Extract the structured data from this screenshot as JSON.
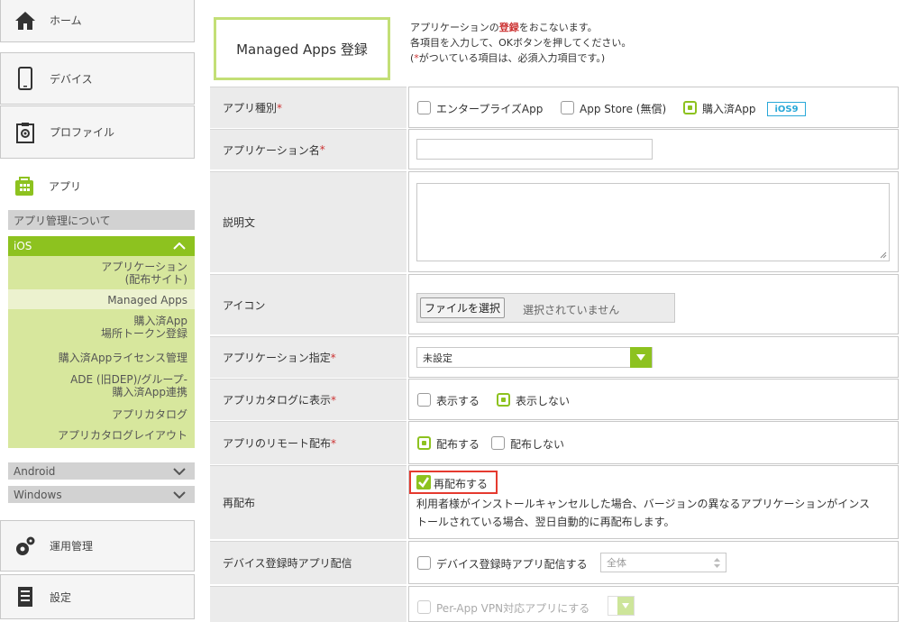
{
  "sidebar": {
    "home": "ホーム",
    "device": "デバイス",
    "profile": "プロファイル",
    "app": "アプリ",
    "app_about": "アプリ管理について",
    "ios": "iOS",
    "submenu": [
      [
        "アプリケーション",
        "(配布サイト)"
      ],
      [
        "Managed Apps"
      ],
      [
        "購入済App",
        "場所トークン登録"
      ],
      [
        "購入済Appライセンス管理"
      ],
      [
        "ADE (旧DEP)/グループ-",
        "購入済App連携"
      ],
      [
        "アプリカタログ"
      ],
      [
        "アプリカタログレイアウト"
      ]
    ],
    "android": "Android",
    "windows": "Windows",
    "operation": "運用管理",
    "settings": "設定"
  },
  "header": {
    "title": "Managed Apps 登録",
    "intro_pre": "アプリケーションの",
    "intro_em": "登録",
    "intro_post": "をおこないます。",
    "intro_line2": "各項目を入力して、OKボタンを押してください。",
    "intro_line3_pre": "(",
    "intro_line3_mark": "*",
    "intro_line3_post": "がついている項目は、必須入力項目です。)"
  },
  "form": {
    "app_type": {
      "label": "アプリ種別",
      "opt1": "エンタープライズApp",
      "opt2": "App Store (無償)",
      "opt3": "購入済App",
      "badge": "iOS9",
      "selected": "購入済App"
    },
    "app_name": {
      "label": "アプリケーション名",
      "value": ""
    },
    "description": {
      "label": "説明文",
      "value": ""
    },
    "icon": {
      "label": "アイコン",
      "button": "ファイルを選択",
      "status": "選択されていません"
    },
    "app_spec": {
      "label": "アプリケーション指定",
      "value": "未設定"
    },
    "catalog": {
      "label": "アプリカタログに表示",
      "opt1": "表示する",
      "opt2": "表示しない",
      "selected": "表示しない"
    },
    "remote": {
      "label": "アプリのリモート配布",
      "opt1": "配布する",
      "opt2": "配布しない",
      "selected": "配布する"
    },
    "redistribute": {
      "label": "再配布",
      "checkbox": "再配布する",
      "checked": true,
      "desc1": "利用者様がインストールキャンセルした場合、バージョンの異なるアプリケーションがインス",
      "desc2": "トールされている場合、翌日自動的に再配布します。"
    },
    "device_reg": {
      "label": "デバイス登録時アプリ配信",
      "checkbox": "デバイス登録時アプリ配信する",
      "select": "全体"
    },
    "per_app_vpn": {
      "checkbox": "Per-App VPN対応アプリにする"
    }
  },
  "colors": {
    "accent": "#8dc21f",
    "submenu_bg": "#d7e79d",
    "required": "#cc3333",
    "highlight": "#e53a2f",
    "badge": "#29a8d8"
  }
}
